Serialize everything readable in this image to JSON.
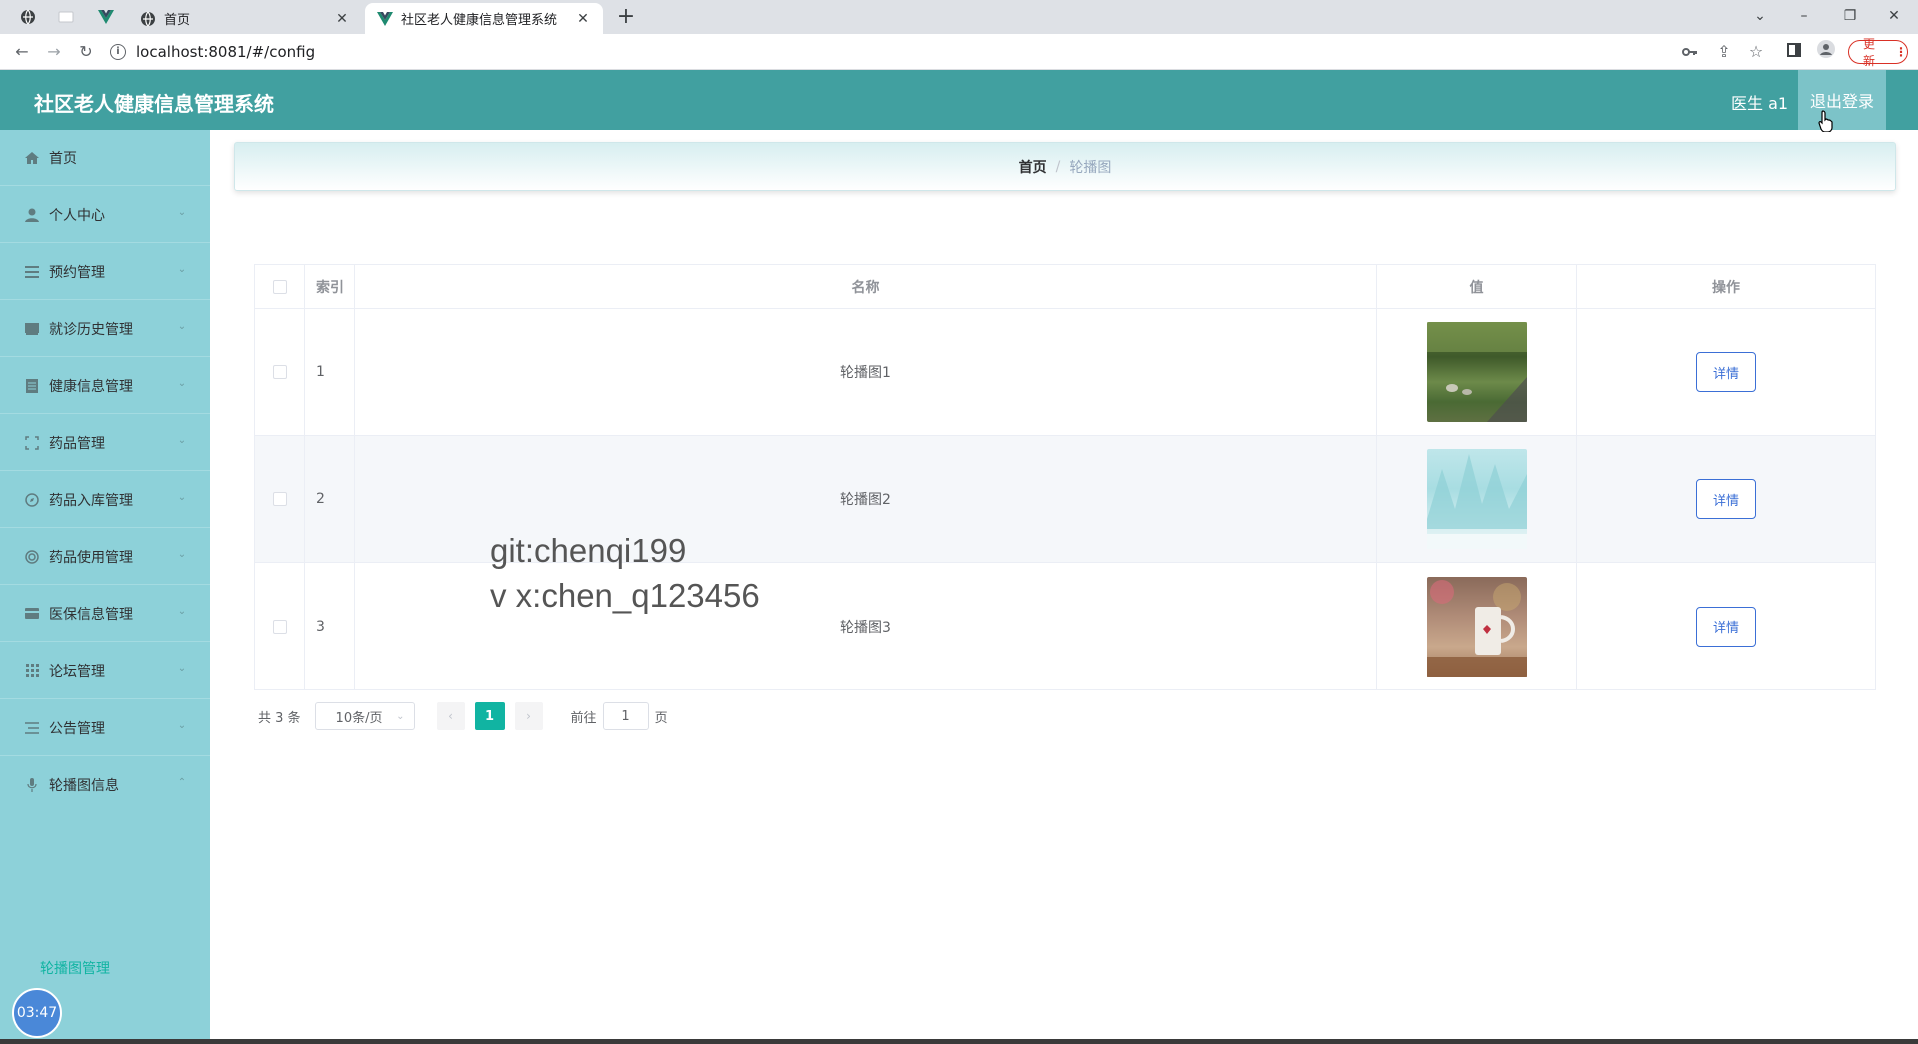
{
  "browser": {
    "tabs": [
      {
        "title": "首页",
        "active": false
      },
      {
        "title": "社区老人健康信息管理系统",
        "active": true
      }
    ],
    "url": "localhost:8081/#/config",
    "update_label": "更新",
    "new_tab": "+"
  },
  "app": {
    "title": "社区老人健康信息管理系统",
    "user": "医生 a1",
    "logout_label": "退出登录"
  },
  "sidebar": {
    "items": [
      {
        "label": "首页",
        "icon": "home-icon",
        "arrow": ""
      },
      {
        "label": "个人中心",
        "icon": "user-icon",
        "arrow": "chevron-down"
      },
      {
        "label": "预约管理",
        "icon": "menu-icon",
        "arrow": "chevron-down"
      },
      {
        "label": "就诊历史管理",
        "icon": "book-icon",
        "arrow": "chevron-down"
      },
      {
        "label": "健康信息管理",
        "icon": "document-icon",
        "arrow": "chevron-down"
      },
      {
        "label": "药品管理",
        "icon": "frame-icon",
        "arrow": "chevron-down"
      },
      {
        "label": "药品入库管理",
        "icon": "compass-icon",
        "arrow": "chevron-down"
      },
      {
        "label": "药品使用管理",
        "icon": "target-icon",
        "arrow": "chevron-down"
      },
      {
        "label": "医保信息管理",
        "icon": "card-icon",
        "arrow": "chevron-down"
      },
      {
        "label": "论坛管理",
        "icon": "grid-icon",
        "arrow": "chevron-down"
      },
      {
        "label": "公告管理",
        "icon": "list-icon",
        "arrow": "chevron-down"
      },
      {
        "label": "轮播图信息",
        "icon": "microphone-icon",
        "arrow": "chevron-up"
      }
    ],
    "sub_item": "轮播图管理",
    "clock": "03:47"
  },
  "breadcrumb": {
    "home": "首页",
    "separator": "/",
    "current": "轮播图"
  },
  "table": {
    "headers": {
      "index": "索引",
      "name": "名称",
      "value": "值",
      "action": "操作"
    },
    "rows": [
      {
        "index": "1",
        "name": "轮播图1",
        "action": "详情",
        "thumb": "park-landscape"
      },
      {
        "index": "2",
        "name": "轮播图2",
        "action": "详情",
        "thumb": "ice-mountains"
      },
      {
        "index": "3",
        "name": "轮播图3",
        "action": "详情",
        "thumb": "coffee-mug"
      }
    ]
  },
  "pagination": {
    "total": "共 3 条",
    "page_size": "10条/页",
    "current_page": "1",
    "goto_label": "前往",
    "goto_value": "1",
    "page_suffix": "页"
  },
  "watermark": {
    "line1": "git:chenqi199",
    "line2": "v x:chen_q123456"
  },
  "colors": {
    "header": "#41a0a0",
    "sidebar": "#8dd1d9",
    "accent": "#11b4a2",
    "button_border": "#3b6fd6"
  }
}
